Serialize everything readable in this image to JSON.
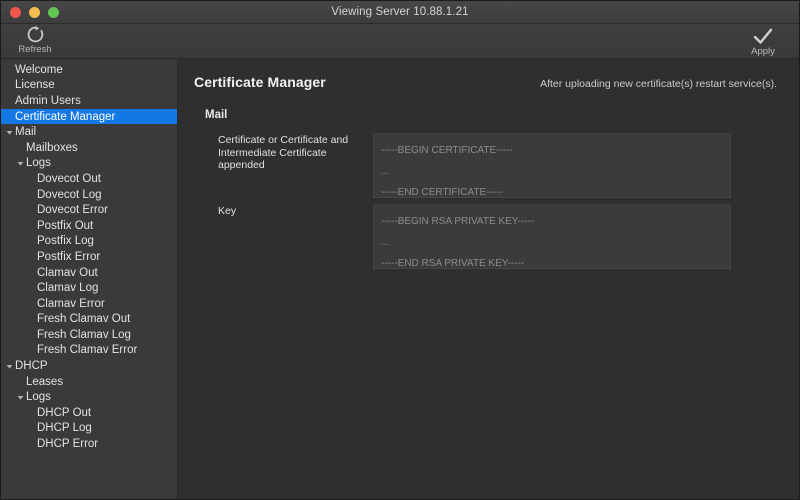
{
  "window": {
    "title": "Viewing Server 10.88.1.21",
    "accent_selection": "#1478e4"
  },
  "toolbar": {
    "refresh_label": "Refresh",
    "refresh_icon": "refresh-circular-arrow-icon",
    "apply_label": "Apply",
    "apply_icon": "checkmark-icon"
  },
  "sidebar": {
    "items": [
      {
        "label": "Welcome",
        "level": 0,
        "twisty": false,
        "selected": false
      },
      {
        "label": "License",
        "level": 0,
        "twisty": false,
        "selected": false
      },
      {
        "label": "Admin Users",
        "level": 0,
        "twisty": false,
        "selected": false
      },
      {
        "label": "Certificate Manager",
        "level": 0,
        "twisty": false,
        "selected": true
      },
      {
        "label": "Mail",
        "level": 0,
        "twisty": true,
        "selected": false
      },
      {
        "label": "Mailboxes",
        "level": 1,
        "twisty": false,
        "selected": false
      },
      {
        "label": "Logs",
        "level": 1,
        "twisty": true,
        "selected": false
      },
      {
        "label": "Dovecot Out",
        "level": 2,
        "twisty": false,
        "selected": false
      },
      {
        "label": "Dovecot Log",
        "level": 2,
        "twisty": false,
        "selected": false
      },
      {
        "label": "Dovecot Error",
        "level": 2,
        "twisty": false,
        "selected": false
      },
      {
        "label": "Postfix Out",
        "level": 2,
        "twisty": false,
        "selected": false
      },
      {
        "label": "Postfix Log",
        "level": 2,
        "twisty": false,
        "selected": false
      },
      {
        "label": "Postfix Error",
        "level": 2,
        "twisty": false,
        "selected": false
      },
      {
        "label": "Clamav Out",
        "level": 2,
        "twisty": false,
        "selected": false
      },
      {
        "label": "Clamav Log",
        "level": 2,
        "twisty": false,
        "selected": false
      },
      {
        "label": "Clamav Error",
        "level": 2,
        "twisty": false,
        "selected": false
      },
      {
        "label": "Fresh Clamav Out",
        "level": 2,
        "twisty": false,
        "selected": false
      },
      {
        "label": "Fresh Clamav Log",
        "level": 2,
        "twisty": false,
        "selected": false
      },
      {
        "label": "Fresh Clamav Error",
        "level": 2,
        "twisty": false,
        "selected": false
      },
      {
        "label": "DHCP",
        "level": 0,
        "twisty": true,
        "selected": false
      },
      {
        "label": "Leases",
        "level": 1,
        "twisty": false,
        "selected": false
      },
      {
        "label": "Logs",
        "level": 1,
        "twisty": true,
        "selected": false
      },
      {
        "label": "DHCP Out",
        "level": 2,
        "twisty": false,
        "selected": false
      },
      {
        "label": "DHCP Log",
        "level": 2,
        "twisty": false,
        "selected": false
      },
      {
        "label": "DHCP Error",
        "level": 2,
        "twisty": false,
        "selected": false
      }
    ]
  },
  "main": {
    "page_title": "Certificate Manager",
    "note": "After uploading new certificate(s) restart service(s).",
    "section_title": "Mail",
    "fields": [
      {
        "label": "Certificate or Certificate and Intermediate Certificate appended",
        "value": "",
        "placeholder": "-----BEGIN CERTIFICATE-----\n...\n-----END CERTIFICATE-----"
      },
      {
        "label": "Key",
        "value": "",
        "placeholder": "-----BEGIN RSA PRIVATE KEY-----\n...\n-----END RSA PRIVATE KEY-----"
      }
    ]
  }
}
